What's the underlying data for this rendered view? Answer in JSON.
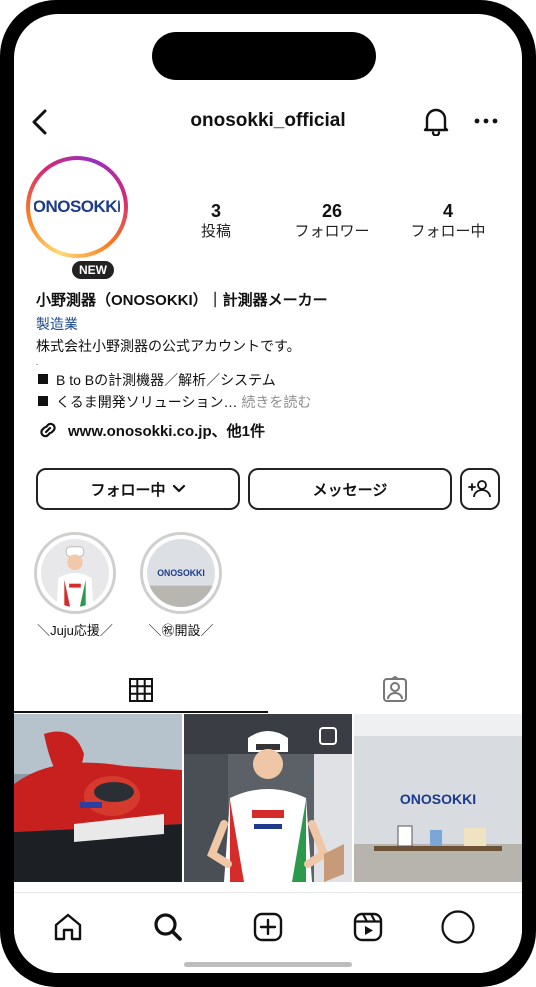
{
  "header": {
    "username": "onosokki_official",
    "back_icon": "chevron-left-icon",
    "bell_icon": "bell-icon",
    "more_icon": "more-horizontal-icon"
  },
  "profile": {
    "avatar_logo_text": "ONOSOKKI",
    "new_badge": "NEW",
    "stats": [
      {
        "count": "3",
        "label": "投稿"
      },
      {
        "count": "26",
        "label": "フォロワー"
      },
      {
        "count": "4",
        "label": "フォロー中"
      }
    ],
    "name": "小野測器（ONOSOKKI）｜計測器メーカー",
    "category": "製造業",
    "bio_line1": "株式会社小野測器の公式アカウントです。",
    "bio_dot": ".",
    "bio_item1": "B to Bの計測機器／解析／システム",
    "bio_item2": "くるま開発ソリューション…",
    "bio_more": "続きを読む",
    "link_text": "www.onosokki.co.jp、他1件"
  },
  "actions": {
    "following_label": "フォロー中",
    "message_label": "メッセージ"
  },
  "highlights": [
    {
      "label": "＼Juju応援／"
    },
    {
      "label": "＼㊗開設／"
    }
  ],
  "grid_posts": [
    {
      "name": "race-car-post"
    },
    {
      "name": "driver-portrait-post"
    },
    {
      "name": "office-logo-post"
    }
  ],
  "photo_text": {
    "office_logo": "ONOSOKKI"
  },
  "colors": {
    "category_link": "#1c4b8c",
    "logo_blue": "#1d3a8c",
    "logo_red": "#d62b2b"
  }
}
